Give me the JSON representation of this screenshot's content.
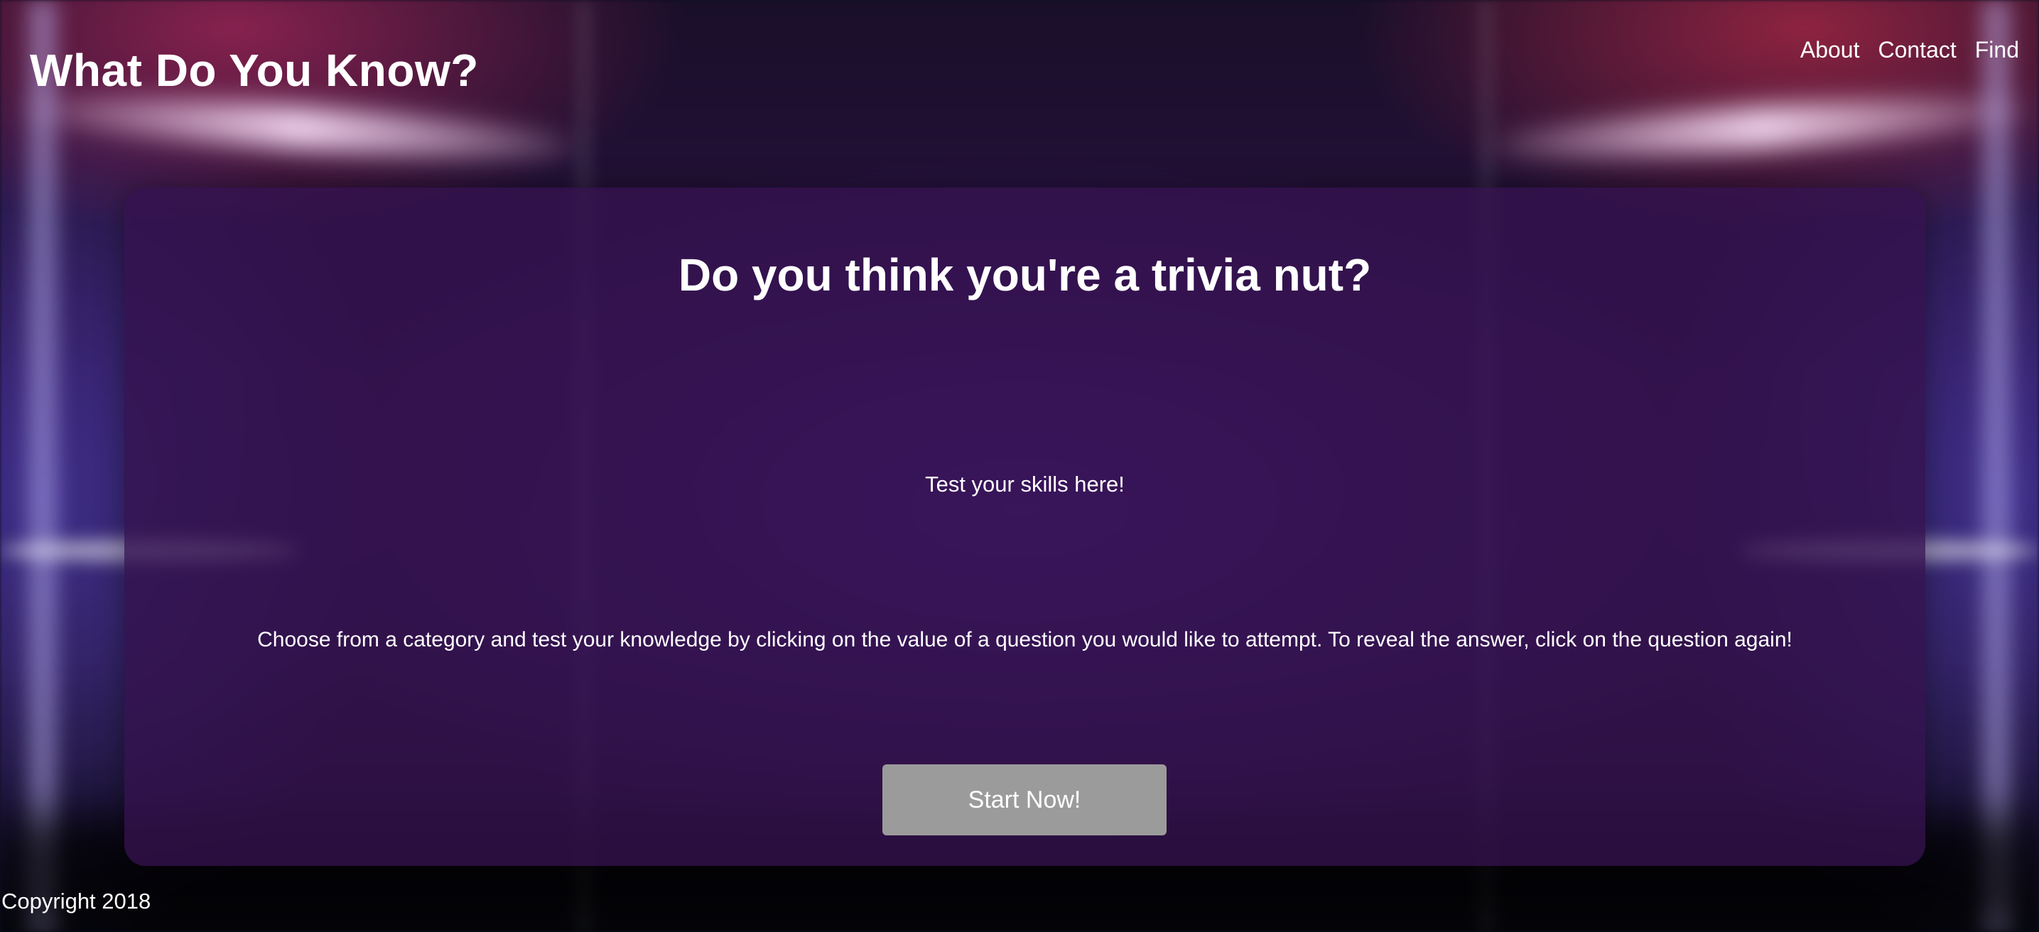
{
  "header": {
    "site_title": "What Do You Know?",
    "nav": [
      {
        "label": "About"
      },
      {
        "label": "Contact"
      },
      {
        "label": "Find"
      }
    ]
  },
  "main": {
    "headline": "Do you think you're a trivia nut?",
    "tagline": "Test your skills here!",
    "instructions": "Choose from a category and test your knowledge by clicking on the value of a question you would like to attempt. To reveal the answer, click on the question again!",
    "start_button_label": "Start Now!"
  },
  "footer": {
    "copyright": "Copyright 2018"
  },
  "colors": {
    "card_background": "#34124e",
    "button_background": "#9b9b9b",
    "text": "#ffffff"
  }
}
